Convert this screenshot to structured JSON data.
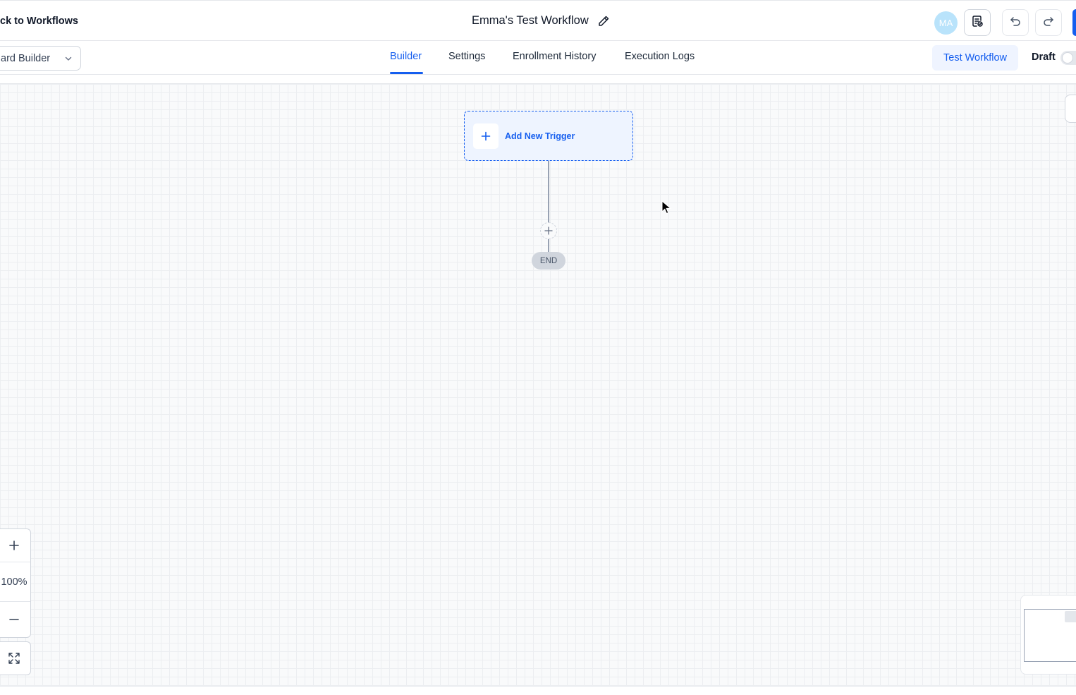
{
  "header": {
    "back_label": "ck to Workflows",
    "title": "Emma's Test Workflow",
    "avatar_initials": "MA"
  },
  "subheader": {
    "builder_select_value": "ard Builder",
    "tabs": [
      {
        "label": "Builder",
        "active": true
      },
      {
        "label": "Settings",
        "active": false
      },
      {
        "label": "Enrollment History",
        "active": false
      },
      {
        "label": "Execution Logs",
        "active": false
      }
    ],
    "test_button_label": "Test Workflow",
    "status_label": "Draft",
    "status_toggle_on": false
  },
  "canvas": {
    "trigger_label": "Add New Trigger",
    "end_label": "END",
    "zoom_level": "100%"
  },
  "colors": {
    "accent": "#155eef",
    "accent_light": "#eef4ff",
    "avatar_bg": "#b9e3fb",
    "canvas_bg": "#f9fafb"
  },
  "icons": [
    "pencil-icon",
    "notes-check-icon",
    "undo-icon",
    "redo-icon",
    "chevron-down-icon",
    "plus-icon",
    "minus-icon",
    "expand-icon",
    "mouse-cursor-icon"
  ]
}
